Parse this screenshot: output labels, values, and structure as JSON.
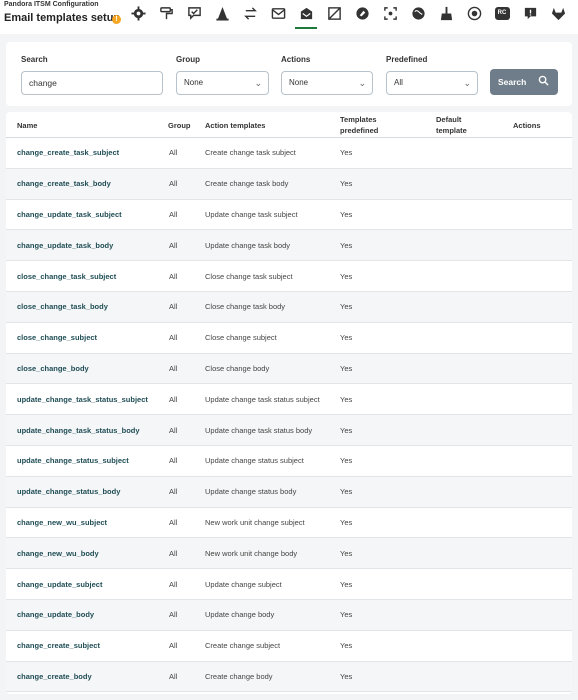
{
  "header": {
    "breadcrumb": "Pandora ITSM Configuration",
    "title": "Email templates setup",
    "info": "!"
  },
  "toolbar": {
    "icons": [
      "gear-icon",
      "paint-roller-icon",
      "chat-check-icon",
      "cone-icon",
      "arrows-icon",
      "envelope-icon",
      "email-template-icon",
      "select-box-icon",
      "tag-icon",
      "focus-icon",
      "globe-icon",
      "broom-icon",
      "target-icon",
      "rc-icon",
      "alert-chat-icon",
      "gitlab-icon"
    ],
    "active_icon": "email-template-icon",
    "rc_label": "RC"
  },
  "search": {
    "search_label": "Search",
    "search_value": "change",
    "group_label": "Group",
    "group_value": "None",
    "actions_label": "Actions",
    "actions_value": "None",
    "predefined_label": "Predefined",
    "predefined_value": "All",
    "button_label": "Search"
  },
  "table": {
    "columns": {
      "name": "Name",
      "group": "Group",
      "action": "Action templates",
      "predefined": "Templates predefined",
      "default": "Default template",
      "actions": "Actions"
    },
    "rows": [
      {
        "name": "change_create_task_subject",
        "group": "All",
        "action": "Create change task subject",
        "predefined": "Yes"
      },
      {
        "name": "change_create_task_body",
        "group": "All",
        "action": "Create change task body",
        "predefined": "Yes"
      },
      {
        "name": "change_update_task_subject",
        "group": "All",
        "action": "Update change task subject",
        "predefined": "Yes"
      },
      {
        "name": "change_update_task_body",
        "group": "All",
        "action": "Update change task body",
        "predefined": "Yes"
      },
      {
        "name": "close_change_task_subject",
        "group": "All",
        "action": "Close change task subject",
        "predefined": "Yes"
      },
      {
        "name": "close_change_task_body",
        "group": "All",
        "action": "Close change task body",
        "predefined": "Yes"
      },
      {
        "name": "close_change_subject",
        "group": "All",
        "action": "Close change subject",
        "predefined": "Yes"
      },
      {
        "name": "close_change_body",
        "group": "All",
        "action": "Close change body",
        "predefined": "Yes"
      },
      {
        "name": "update_change_task_status_subject",
        "group": "All",
        "action": "Update change task status subject",
        "predefined": "Yes"
      },
      {
        "name": "update_change_task_status_body",
        "group": "All",
        "action": "Update change task status body",
        "predefined": "Yes"
      },
      {
        "name": "update_change_status_subject",
        "group": "All",
        "action": "Update change status subject",
        "predefined": "Yes"
      },
      {
        "name": "update_change_status_body",
        "group": "All",
        "action": "Update change status body",
        "predefined": "Yes"
      },
      {
        "name": "change_new_wu_subject",
        "group": "All",
        "action": "New work unit change subject",
        "predefined": "Yes"
      },
      {
        "name": "change_new_wu_body",
        "group": "All",
        "action": "New work unit change body",
        "predefined": "Yes"
      },
      {
        "name": "change_update_subject",
        "group": "All",
        "action": "Update change subject",
        "predefined": "Yes"
      },
      {
        "name": "change_update_body",
        "group": "All",
        "action": "Update change body",
        "predefined": "Yes"
      },
      {
        "name": "change_create_subject",
        "group": "All",
        "action": "Create change subject",
        "predefined": "Yes"
      },
      {
        "name": "change_create_body",
        "group": "All",
        "action": "Create change body",
        "predefined": "Yes"
      }
    ]
  },
  "colors": {
    "accent": "#1d7a3a",
    "link": "#1f4d55",
    "button": "#6f7c89",
    "info": "#f5a623"
  }
}
